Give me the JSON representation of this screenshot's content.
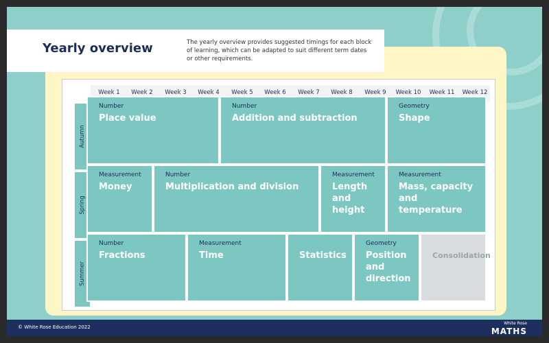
{
  "header": {
    "title": "Yearly overview",
    "intro": "The yearly overview provides suggested timings for each block of learning, which can be adapted to suit different term dates or other requirements."
  },
  "weeks": [
    "Week 1",
    "Week 2",
    "Week 3",
    "Week 4",
    "Week 5",
    "Week 6",
    "Week 7",
    "Week 8",
    "Week 9",
    "Week 10",
    "Week 11",
    "Week 12"
  ],
  "terms": [
    "Autumn",
    "Spring",
    "Summer"
  ],
  "blocks": {
    "autumn_place_value": {
      "category": "Number",
      "name": "Place value"
    },
    "autumn_addition": {
      "category": "Number",
      "name": "Addition and subtraction"
    },
    "autumn_shape": {
      "category": "Geometry",
      "name": "Shape"
    },
    "spring_money": {
      "category": "Measurement",
      "name": "Money"
    },
    "spring_multiplication": {
      "category": "Number",
      "name": "Multiplication and division"
    },
    "spring_length": {
      "category": "Measurement",
      "name": "Length and height"
    },
    "spring_mass": {
      "category": "Measurement",
      "name": "Mass, capacity and temperature"
    },
    "summer_fractions": {
      "category": "Number",
      "name": "Fractions"
    },
    "summer_time": {
      "category": "Measurement",
      "name": "Time"
    },
    "summer_statistics": {
      "category": "",
      "name": "Statistics"
    },
    "summer_position": {
      "category": "Geometry",
      "name": "Position and direction"
    },
    "summer_consolidation": {
      "category": "",
      "name": "Consolidation"
    }
  },
  "footer": {
    "copyright": "© White Rose Education 2022",
    "brand_top": "White Rose",
    "brand_bottom": "MATHS"
  },
  "colors": {
    "background": "#8ecfca",
    "block": "#7cc7c1",
    "navy": "#1d2f5e",
    "cream": "#fff6c8",
    "consolidation": "#d9dcdf"
  }
}
